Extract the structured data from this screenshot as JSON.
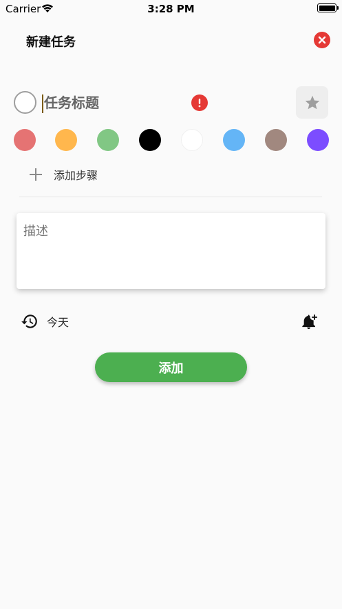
{
  "status_bar": {
    "carrier": "Carrier",
    "time": "3:28 PM"
  },
  "header": {
    "title": "新建任务",
    "close_icon": "close-circle-icon"
  },
  "task": {
    "title_placeholder": "任务标题",
    "title_value": "",
    "priority_icon": "exclamation-icon",
    "star_icon": "star-icon"
  },
  "colors": [
    {
      "name": "red",
      "hex": "#e57373"
    },
    {
      "name": "orange",
      "hex": "#ffb74d"
    },
    {
      "name": "green",
      "hex": "#81c784"
    },
    {
      "name": "black",
      "hex": "#000000"
    },
    {
      "name": "white",
      "hex": "#ffffff"
    },
    {
      "name": "blue",
      "hex": "#64b5f6"
    },
    {
      "name": "brown",
      "hex": "#a1887f"
    },
    {
      "name": "purple",
      "hex": "#7c4dff"
    }
  ],
  "steps": {
    "add_label": "添加步骤"
  },
  "description": {
    "placeholder": "描述"
  },
  "schedule": {
    "date_label": "今天",
    "date_icon": "history-icon",
    "reminder_icon": "bell-plus-icon"
  },
  "actions": {
    "add_label": "添加"
  },
  "theme": {
    "accent": "#4caf50",
    "danger": "#e53935"
  }
}
